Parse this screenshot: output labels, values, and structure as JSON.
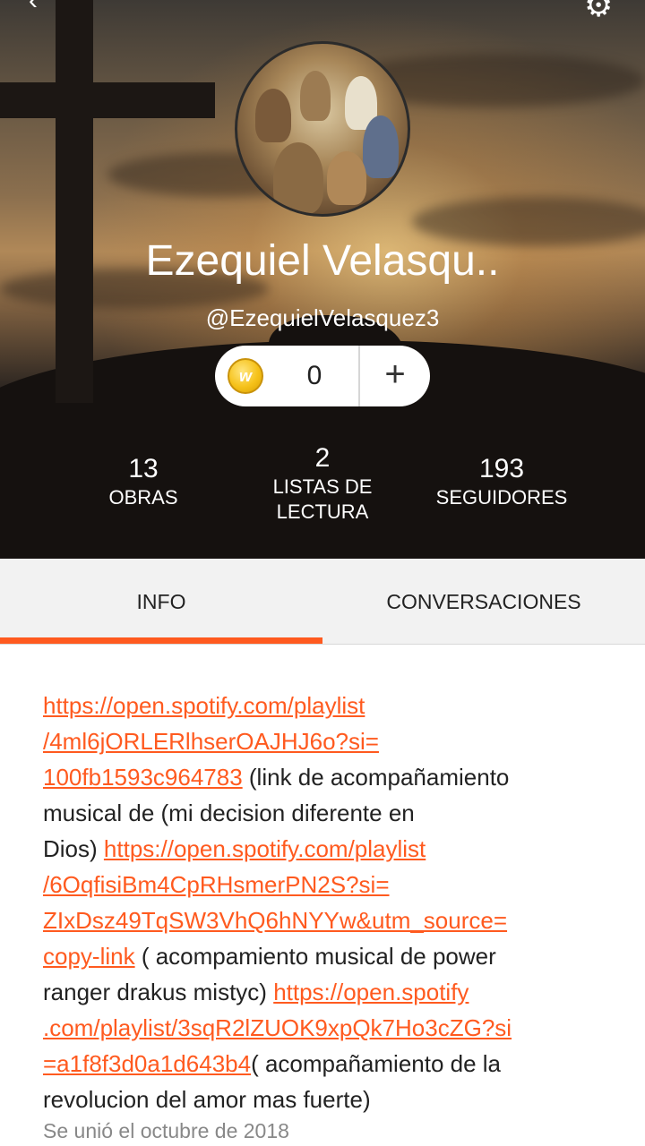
{
  "profile": {
    "display_name": "Ezequiel Velasqu..",
    "handle": "@EzequielVelasquez3",
    "coins": "0",
    "coin_symbol": "w",
    "add_symbol": "+"
  },
  "stats": [
    {
      "value": "13",
      "label_line1": "OBRAS",
      "label_line2": ""
    },
    {
      "value": "2",
      "label_line1": "LISTAS DE",
      "label_line2": "LECTURA"
    },
    {
      "value": "193",
      "label_line1": "SEGUIDORES",
      "label_line2": ""
    }
  ],
  "tabs": [
    {
      "label": "INFO",
      "active": true
    },
    {
      "label": "CONVERSACIONES",
      "active": false
    }
  ],
  "bio": {
    "link1_part1": "https://open.spotify.com/playlist",
    "link1_part2": "/4ml6jORLERlhserOAJHJ6o?si=",
    "link1_part3": "100fb1593c964783",
    "text1_a": " (link de acompañamiento",
    "text1_b": "musical de (mi decision diferente en",
    "text1_c": "Dios) ",
    "link2_part1": "https://open.spotify.com/playlist",
    "link2_part2": "/6OqfisiBm4CpRHsmerPN2S?si=",
    "link2_part3": "ZIxDsz49TqSW3VhQ6hNYYw&utm_source=",
    "link2_part4": "copy-link",
    "text2_a": " ( acompamiento musical de power",
    "text2_b": "ranger drakus mistyc) ",
    "link3_part1": "https://open.spotify",
    "link3_part2": ".com/playlist/3sqR2lZUOK9xpQk7Ho3cZG?si",
    "link3_part3": "=a1f8f3d0a1d643b4",
    "text3_a": "( acompañamiento de la",
    "text3_b": "revolucion del amor mas fuerte)"
  },
  "joined": "Se unió el octubre de 2018",
  "icons": {
    "back": "back-arrow-icon",
    "settings": "gear-icon"
  },
  "colors": {
    "accent": "#ff5a1f",
    "tab_background": "#f2f2f2",
    "secondary_text": "#888888"
  }
}
